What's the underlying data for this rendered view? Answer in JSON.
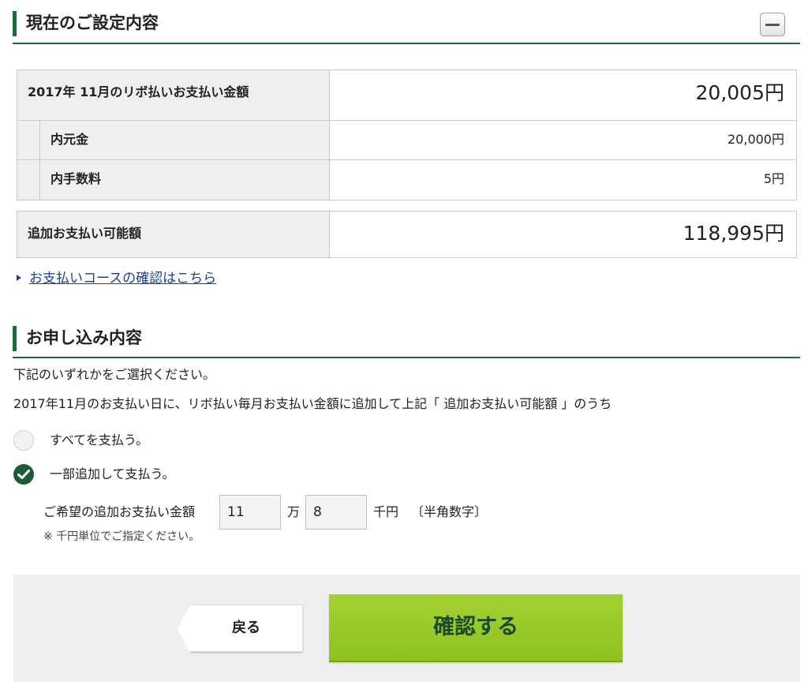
{
  "current_settings": {
    "title": "現在のご設定内容",
    "collapse_icon": "minus-icon",
    "revolving_payment": {
      "label": "2017年 11月のリボ払いお支払い金額",
      "value": "20,005円",
      "principal_label": "内元金",
      "principal_value": "20,000円",
      "fee_label": "内手数料",
      "fee_value": "5円"
    },
    "additional_available": {
      "label": "追加お支払い可能額",
      "value": "118,995円"
    },
    "course_link": "お支払いコースの確認はこちら"
  },
  "application": {
    "title": "お申し込み内容",
    "instruction": "下記のいずれかをご選択ください。",
    "description": "2017年11月のお支払い日に、リボ払い毎月お支払い金額に追加して上記「 追加お支払い可能額 」のうち",
    "options": [
      {
        "label": "すべてを支払う。",
        "selected": false
      },
      {
        "label": "一部追加して支払う。",
        "selected": true
      }
    ],
    "amount": {
      "label": "ご希望の追加お支払い金額",
      "man_value": "11",
      "man_unit": "万",
      "sen_value": "8",
      "sen_unit": "千円",
      "hint": "〔半角数字〕",
      "note": "※ 千円単位でご指定ください。"
    }
  },
  "footer": {
    "back_label": "戻る",
    "confirm_label": "確認する"
  },
  "colors": {
    "brand_green": "#1f6a3c",
    "confirm_green": "#9ccb2a",
    "link_blue": "#1a3f9e"
  }
}
